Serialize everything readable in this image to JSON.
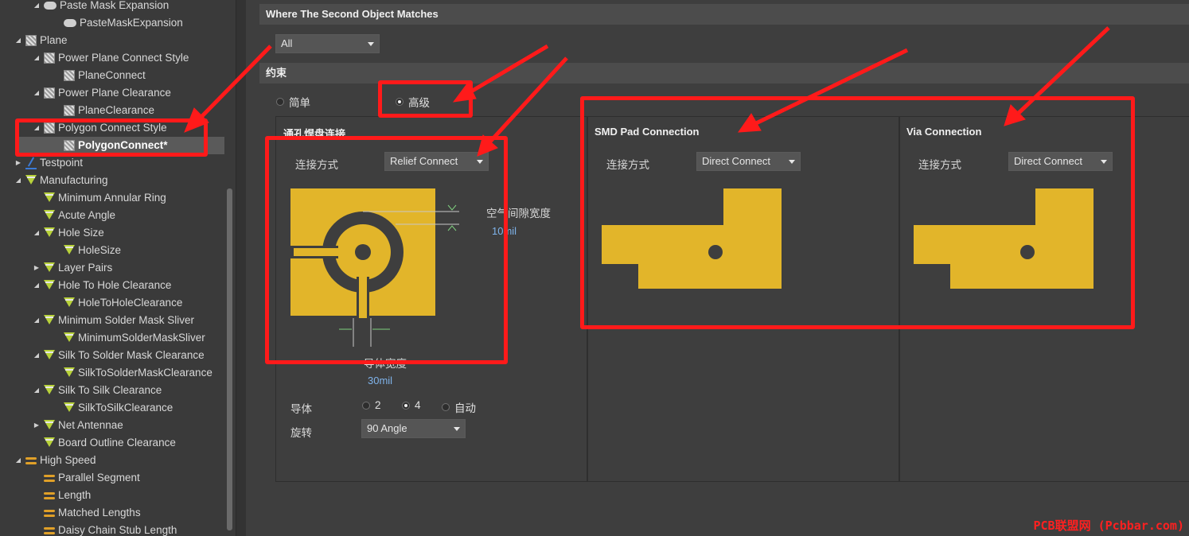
{
  "tree": {
    "items": [
      {
        "label": "Paste Mask Expansion",
        "level": 2,
        "icon": "pill",
        "toggle": "expanded"
      },
      {
        "label": "PasteMaskExpansion",
        "level": 3,
        "icon": "pill",
        "toggle": ""
      },
      {
        "label": "Plane",
        "level": 1,
        "icon": "plane",
        "toggle": "expanded"
      },
      {
        "label": "Power Plane Connect Style",
        "level": 2,
        "icon": "plane",
        "toggle": "expanded"
      },
      {
        "label": "PlaneConnect",
        "level": 3,
        "icon": "plane",
        "toggle": ""
      },
      {
        "label": "Power Plane Clearance",
        "level": 2,
        "icon": "plane",
        "toggle": "expanded"
      },
      {
        "label": "PlaneClearance",
        "level": 3,
        "icon": "plane",
        "toggle": ""
      },
      {
        "label": "Polygon Connect Style",
        "level": 2,
        "icon": "plane",
        "toggle": "expanded"
      },
      {
        "label": "PolygonConnect*",
        "level": 3,
        "icon": "plane",
        "toggle": "",
        "selected": true
      },
      {
        "label": "Testpoint",
        "level": 1,
        "icon": "tp",
        "toggle": "collapsed"
      },
      {
        "label": "Manufacturing",
        "level": 1,
        "icon": "mfg",
        "toggle": "expanded"
      },
      {
        "label": "Minimum Annular Ring",
        "level": 2,
        "icon": "mfg",
        "toggle": ""
      },
      {
        "label": "Acute Angle",
        "level": 2,
        "icon": "mfg",
        "toggle": ""
      },
      {
        "label": "Hole Size",
        "level": 2,
        "icon": "mfg",
        "toggle": "expanded"
      },
      {
        "label": "HoleSize",
        "level": 3,
        "icon": "mfg",
        "toggle": ""
      },
      {
        "label": "Layer Pairs",
        "level": 2,
        "icon": "mfg",
        "toggle": "collapsed"
      },
      {
        "label": "Hole To Hole Clearance",
        "level": 2,
        "icon": "mfg",
        "toggle": "expanded"
      },
      {
        "label": "HoleToHoleClearance",
        "level": 3,
        "icon": "mfg",
        "toggle": ""
      },
      {
        "label": "Minimum Solder Mask Sliver",
        "level": 2,
        "icon": "mfg",
        "toggle": "expanded"
      },
      {
        "label": "MinimumSolderMaskSliver",
        "level": 3,
        "icon": "mfg",
        "toggle": ""
      },
      {
        "label": "Silk To Solder Mask Clearance",
        "level": 2,
        "icon": "mfg",
        "toggle": "expanded"
      },
      {
        "label": "SilkToSolderMaskClearance",
        "level": 3,
        "icon": "mfg",
        "toggle": ""
      },
      {
        "label": "Silk To Silk Clearance",
        "level": 2,
        "icon": "mfg",
        "toggle": "expanded"
      },
      {
        "label": "SilkToSilkClearance",
        "level": 3,
        "icon": "mfg",
        "toggle": ""
      },
      {
        "label": "Net Antennae",
        "level": 2,
        "icon": "mfg",
        "toggle": "collapsed"
      },
      {
        "label": "Board Outline Clearance",
        "level": 2,
        "icon": "mfg",
        "toggle": ""
      },
      {
        "label": "High Speed",
        "level": 1,
        "icon": "hs",
        "toggle": "expanded"
      },
      {
        "label": "Parallel Segment",
        "level": 2,
        "icon": "hs",
        "toggle": ""
      },
      {
        "label": "Length",
        "level": 2,
        "icon": "hs",
        "toggle": ""
      },
      {
        "label": "Matched Lengths",
        "level": 2,
        "icon": "hs",
        "toggle": ""
      },
      {
        "label": "Daisy Chain Stub Length",
        "level": 2,
        "icon": "hs",
        "toggle": ""
      }
    ]
  },
  "second_object": {
    "title": "Where The Second Object Matches",
    "scope_value": "All"
  },
  "constraints": {
    "title": "约束",
    "mode_simple": "简单",
    "mode_advanced": "高级",
    "selected_mode": "advanced"
  },
  "through_hole": {
    "title": "通孔焊盘连接",
    "connect_label": "连接方式",
    "connect_value": "Relief Connect",
    "air_gap_label": "空气间隙宽度",
    "air_gap_value": "10mil",
    "conductor_width_label": "导体宽度",
    "conductor_width_value": "30mil",
    "conductors_label": "导体",
    "conductors_options": [
      "2",
      "4",
      "自动"
    ],
    "conductors_selected": "4",
    "rotation_label": "旋转",
    "rotation_value": "90 Angle"
  },
  "smd": {
    "title": "SMD Pad Connection",
    "connect_label": "连接方式",
    "connect_value": "Direct Connect"
  },
  "via": {
    "title": "Via Connection",
    "connect_label": "连接方式",
    "connect_value": "Direct Connect"
  },
  "colors": {
    "copper": "#e2b52a",
    "annotation": "#ff1a1a",
    "panel_bg": "#3e3e3e",
    "value_text": "#7fb3ea"
  },
  "watermark": "PCB联盟网 (Pcbbar.com)"
}
